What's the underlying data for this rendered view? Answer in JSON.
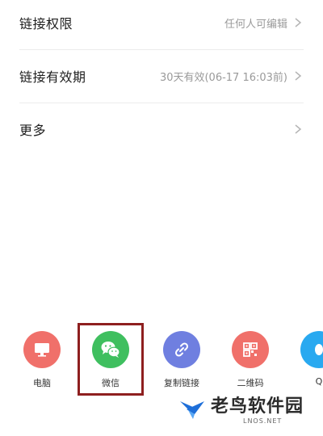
{
  "settings": {
    "link_permission": {
      "label": "链接权限",
      "value": "任何人可编辑"
    },
    "link_validity": {
      "label": "链接有效期",
      "value": "30天有效(06-17 16:03前)"
    },
    "more": {
      "label": "更多"
    }
  },
  "share_options": [
    {
      "label": "电脑",
      "icon": "monitor-icon",
      "color": "#f0706a"
    },
    {
      "label": "微信",
      "icon": "wechat-icon",
      "color": "#3fbf5f"
    },
    {
      "label": "复制链接",
      "icon": "link-icon",
      "color": "#6f7fe0"
    },
    {
      "label": "二维码",
      "icon": "qr-code-icon",
      "color": "#f0706a"
    },
    {
      "label": "Q",
      "icon": "qq-icon",
      "color": "#29a9f0"
    }
  ],
  "watermark": {
    "title": "老鸟软件园",
    "sub": "LNOS.NET"
  }
}
